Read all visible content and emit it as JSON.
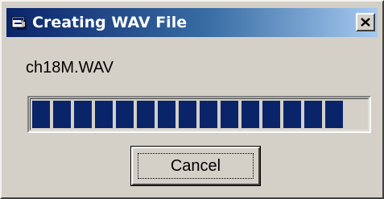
{
  "window": {
    "title": "Creating WAV File",
    "close_label": "×"
  },
  "file": {
    "name": "ch18M.WAV"
  },
  "progress": {
    "filled_blocks": 15,
    "fraction": 0.98,
    "fill_color": "#0a246a"
  },
  "buttons": {
    "cancel_label": "Cancel"
  },
  "icons": {
    "window_icon": "app-window-icon",
    "close": "close-icon"
  },
  "colors": {
    "titlebar_start": "#0a246a",
    "titlebar_end": "#a6caf0",
    "dialog_face": "#d4d0c8"
  }
}
